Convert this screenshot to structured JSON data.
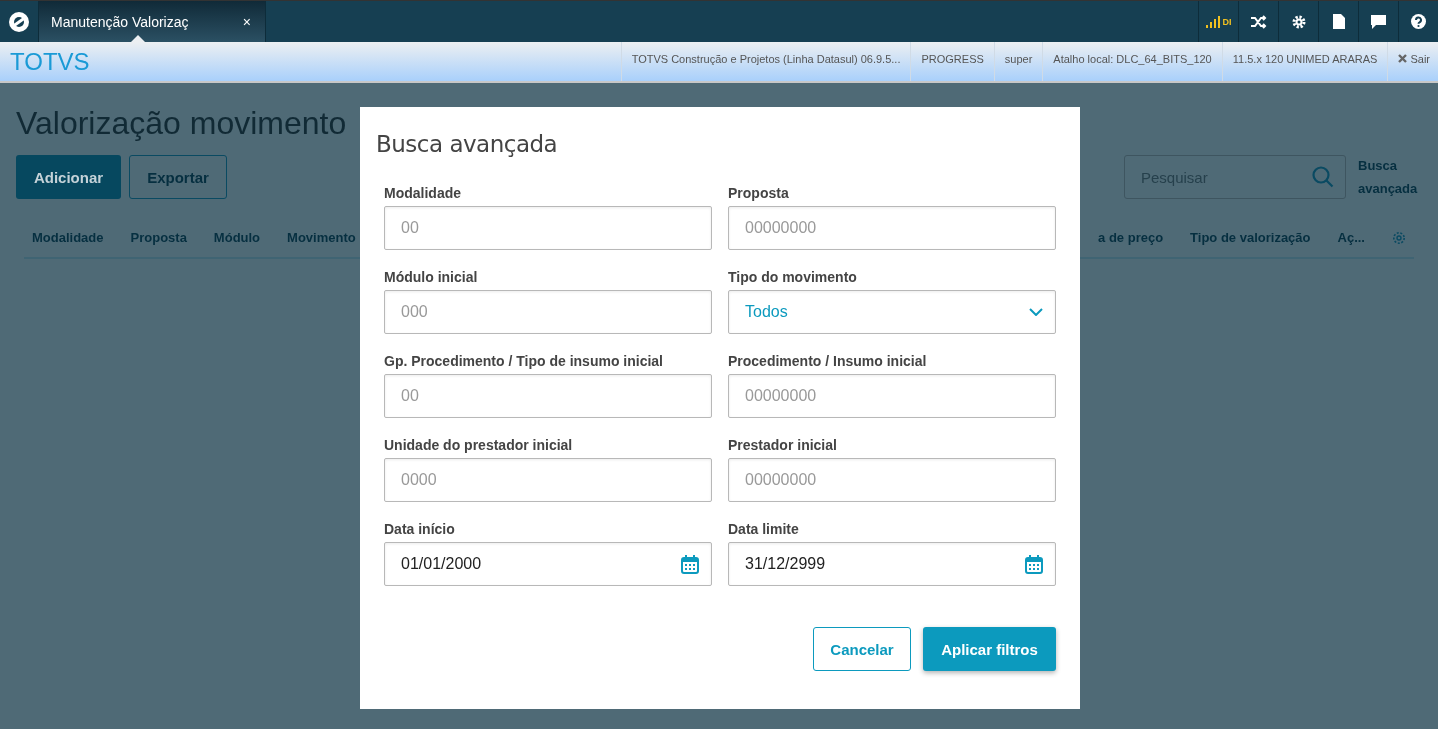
{
  "top_bar": {
    "tabs": [
      {
        "label": "Manutenção Valorizaç",
        "close": "×",
        "selected": true
      }
    ],
    "connection_label": "DI"
  },
  "header_bar": {
    "brand": "TOTVS",
    "info": [
      "TOTVS Construção e Projetos (Linha Datasul) 06.9.5...",
      "PROGRESS",
      "super",
      "Atalho local: DLC_64_BITS_120",
      "11.5.x 120 UNIMED ARARAS"
    ],
    "logout": "Sair"
  },
  "page": {
    "title": "Valorização movimento",
    "actions": [
      {
        "label": "Adicionar",
        "kind": "primary"
      },
      {
        "label": "Exportar",
        "kind": "secondary"
      }
    ],
    "search": {
      "placeholder": "Pesquisar"
    },
    "advanced_search_link": "Busca avançada",
    "columns_left": [
      "Modalidade",
      "Proposta",
      "Módulo",
      "Movimento"
    ],
    "columns_right": [
      "a de preço",
      "Tipo de valorização",
      "Aç..."
    ]
  },
  "dialog": {
    "title": "Busca avançada",
    "fields": [
      {
        "label": "Modalidade",
        "kind": "text",
        "placeholder": "00"
      },
      {
        "label": "Proposta",
        "kind": "text",
        "placeholder": "00000000"
      },
      {
        "label": "Módulo inicial",
        "kind": "text",
        "placeholder": "000"
      },
      {
        "label": "Tipo do movimento",
        "kind": "select",
        "value": "Todos"
      },
      {
        "label": "Gp. Procedimento / Tipo de insumo inicial",
        "kind": "text",
        "placeholder": "00"
      },
      {
        "label": "Procedimento / Insumo inicial",
        "kind": "text",
        "placeholder": "00000000"
      },
      {
        "label": "Unidade do prestador inicial",
        "kind": "text",
        "placeholder": "0000"
      },
      {
        "label": "Prestador inicial",
        "kind": "text",
        "placeholder": "00000000"
      },
      {
        "label": "Data início",
        "kind": "date",
        "value": "01/01/2000"
      },
      {
        "label": "Data limite",
        "kind": "date",
        "value": "31/12/2999"
      }
    ],
    "buttons": [
      {
        "label": "Cancelar",
        "kind": "secondary"
      },
      {
        "label": "Aplicar filtros",
        "kind": "primary"
      }
    ]
  }
}
